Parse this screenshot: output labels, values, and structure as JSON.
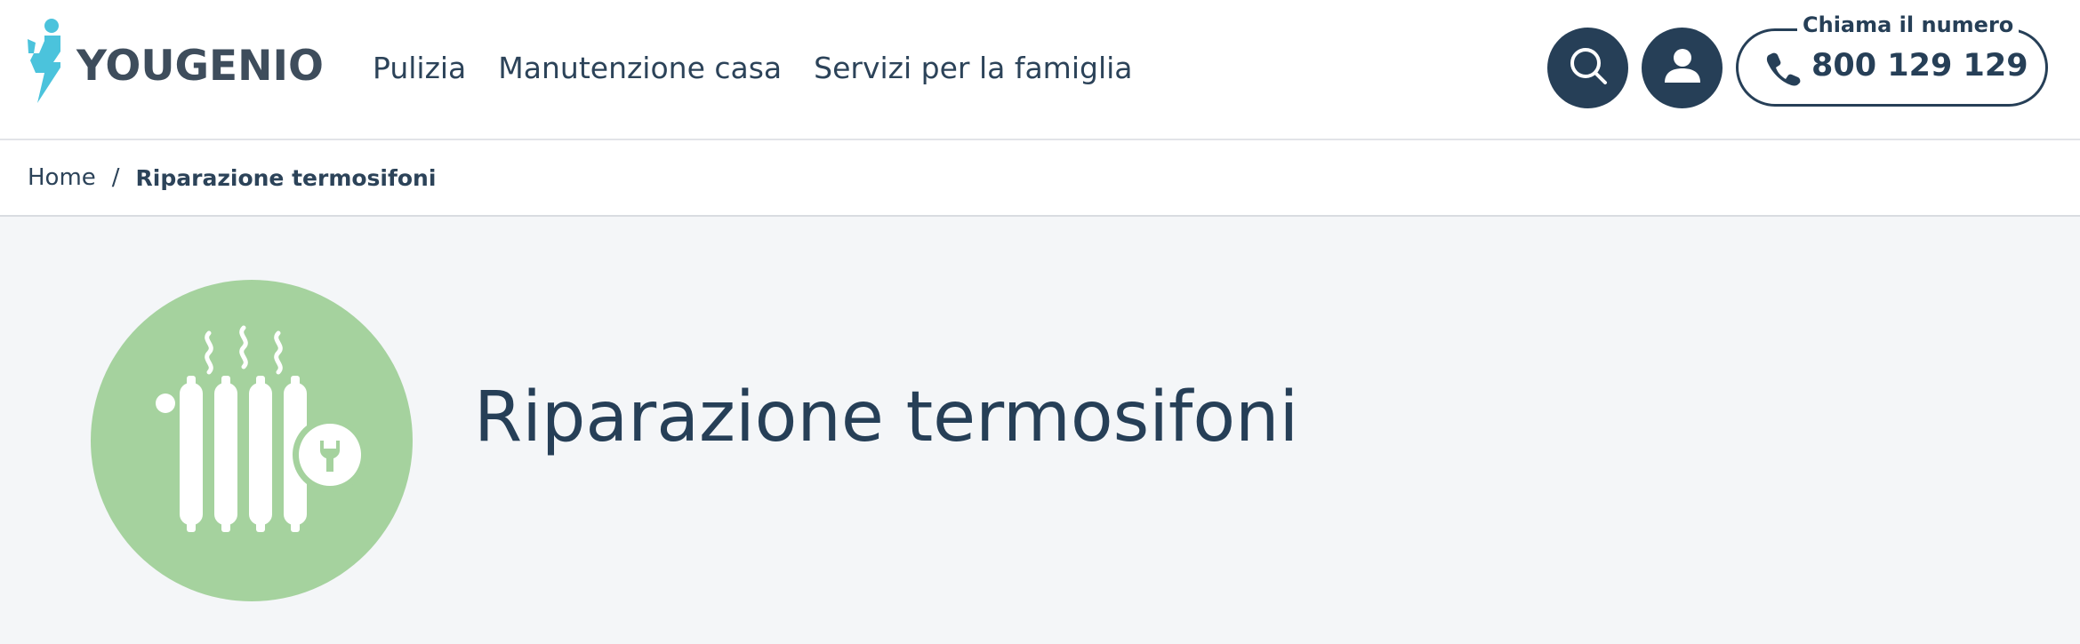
{
  "brand": {
    "name": "YOUGENIO",
    "logo_icon": "yougenio-genie-logo-icon",
    "accent_color": "#4bc3dc",
    "text_color": "#3e4d5c"
  },
  "nav": {
    "items": [
      {
        "label": "Pulizia"
      },
      {
        "label": "Manutenzione casa"
      },
      {
        "label": "Servizi per la famiglia"
      }
    ]
  },
  "header_actions": {
    "search_icon": "search-icon",
    "user_icon": "user-icon",
    "button_color": "#263f57",
    "phone": {
      "label": "Chiama il numero",
      "number": "800 129 129",
      "icon": "phone-icon"
    }
  },
  "breadcrumb": {
    "home": "Home",
    "separator": "/",
    "current": "Riparazione termosifoni"
  },
  "hero": {
    "title": "Riparazione termosifoni",
    "icon": "radiator-repair-icon",
    "icon_bg_color": "#a5d29e",
    "background_color": "#f4f6f8"
  }
}
